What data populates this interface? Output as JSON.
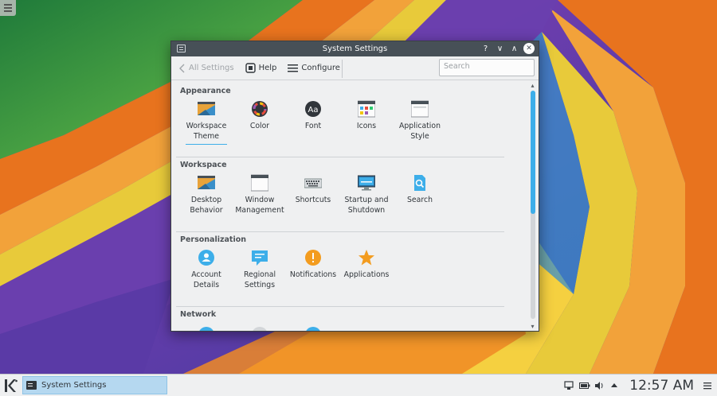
{
  "window": {
    "title": "System Settings",
    "help_glyph": "?",
    "min_glyph": "∨",
    "max_glyph": "∧",
    "close_glyph": "✕"
  },
  "toolbar": {
    "back_label": "All Settings",
    "help_label": "Help",
    "configure_label": "Configure",
    "search_placeholder": "Search"
  },
  "sections": [
    {
      "header": "Appearance",
      "items": [
        {
          "line1": "Workspace",
          "line2": "Theme",
          "icon": "workspace-theme-icon",
          "selected": true
        },
        {
          "line1": "Color",
          "line2": "",
          "icon": "color-icon"
        },
        {
          "line1": "Font",
          "line2": "",
          "icon": "font-icon"
        },
        {
          "line1": "Icons",
          "line2": "",
          "icon": "icons-icon"
        },
        {
          "line1": "Application",
          "line2": "Style",
          "icon": "application-style-icon"
        }
      ]
    },
    {
      "header": "Workspace",
      "items": [
        {
          "line1": "Desktop",
          "line2": "Behavior",
          "icon": "desktop-behavior-icon"
        },
        {
          "line1": "Window",
          "line2": "Management",
          "icon": "window-management-icon"
        },
        {
          "line1": "Shortcuts",
          "line2": "",
          "icon": "shortcuts-icon"
        },
        {
          "line1": "Startup and",
          "line2": "Shutdown",
          "icon": "startup-shutdown-icon"
        },
        {
          "line1": "Search",
          "line2": "",
          "icon": "search-icon"
        }
      ]
    },
    {
      "header": "Personalization",
      "items": [
        {
          "line1": "Account",
          "line2": "Details",
          "icon": "account-details-icon"
        },
        {
          "line1": "Regional",
          "line2": "Settings",
          "icon": "regional-settings-icon"
        },
        {
          "line1": "Notifications",
          "line2": "",
          "icon": "notifications-icon"
        },
        {
          "line1": "Applications",
          "line2": "",
          "icon": "applications-icon"
        }
      ]
    },
    {
      "header": "Network",
      "items": []
    }
  ],
  "taskbar": {
    "task_label": "System Settings",
    "clock": "12:57 AM"
  },
  "colors": {
    "accent": "#3daee9",
    "titlebar": "#475057",
    "window_bg": "#eff0f1"
  }
}
